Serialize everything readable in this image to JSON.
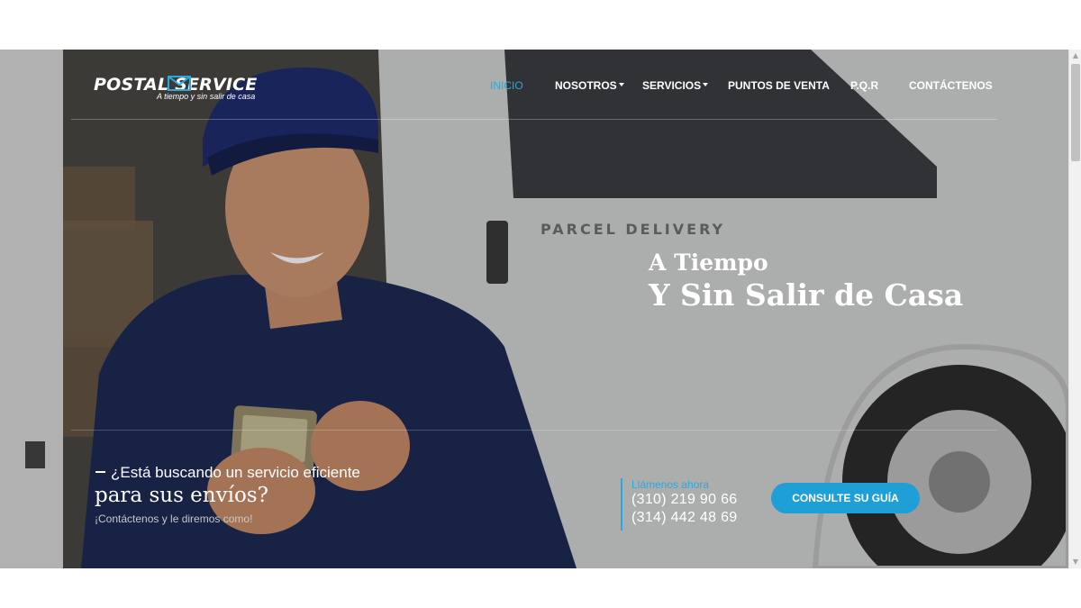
{
  "brand": {
    "logo_text": "POSTAL SERVICE",
    "tagline": "A tiempo y sin salir de casa"
  },
  "nav": {
    "items": [
      {
        "label": "INICIO",
        "active": true,
        "dropdown": false
      },
      {
        "label": "NOSOTROS",
        "active": false,
        "dropdown": true
      },
      {
        "label": "SERVICIOS",
        "active": false,
        "dropdown": true
      },
      {
        "label": "PUNTOS DE VENTA",
        "active": false,
        "dropdown": false
      },
      {
        "label": "P.Q.R",
        "active": false,
        "dropdown": false
      },
      {
        "label": "CONTÁCTENOS",
        "active": false,
        "dropdown": false
      }
    ]
  },
  "hero": {
    "headline_small": "A Tiempo",
    "headline_large": "Y Sin Salir de Casa",
    "van_text": "PARCEL DELIVERY"
  },
  "promo": {
    "line1": "¿Está buscando un servicio eficiente",
    "line2": "para sus envíos?",
    "line3": "¡Contáctenos y le diremos como!"
  },
  "contact": {
    "label": "Llámenos ahora",
    "phone1": "(310) 219 90 66",
    "phone2": "(314) 442 48 69"
  },
  "cta": {
    "label": "CONSULTE SU GUÍA"
  },
  "colors": {
    "accent": "#2aa9df",
    "button": "#1e9fd6",
    "text": "#ffffff"
  }
}
